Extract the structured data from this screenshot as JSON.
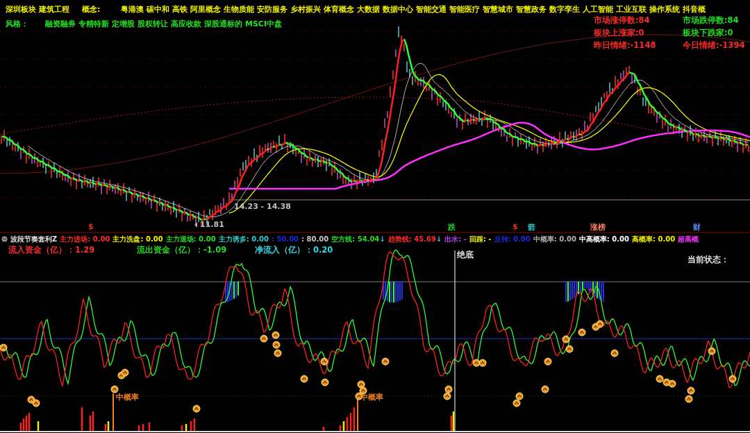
{
  "header": {
    "board": "深圳板块",
    "industry": "建筑工程",
    "concept_label": "概念:",
    "concepts": [
      "粤港澳",
      "碳中和",
      "高铁",
      "阿里概念",
      "生物质能",
      "安防服务",
      "乡村振兴",
      "体育概念",
      "大数据",
      "数据中心",
      "智能交通",
      "智能医疗",
      "智慧城市",
      "智慧政务",
      "数字孪生",
      "人工智能",
      "工业互联",
      "操作系统",
      "抖音概"
    ],
    "style_label": "风格：",
    "styles": [
      "融资融券",
      "专精特新",
      "定增股",
      "股权转让",
      "高应收款",
      "深股通标的",
      "MSCI中盘"
    ]
  },
  "stats": [
    {
      "text": "市场涨停数:84",
      "color": "#ff2a2a"
    },
    {
      "text": "市场跌停数:84",
      "color": "#22dd22"
    },
    {
      "text": "板块上涨家:0",
      "color": "#ff2a2a"
    },
    {
      "text": "板块下跌家:0",
      "color": "#22dd22"
    },
    {
      "text": "昨日情绪:-1148",
      "color": "#ff2a2a"
    },
    {
      "text": "今日情绪:-1394",
      "color": "#ff2a2a"
    }
  ],
  "price_labels": [
    "14.23 - 14.38",
    "11.81"
  ],
  "signal_marks": [
    {
      "text": "$",
      "color": "#e03020"
    },
    {
      "text": "跌",
      "color": "#22cc22"
    },
    {
      "text": "$",
      "color": "#e03020"
    },
    {
      "text": "箭",
      "color": "#30c8c8"
    },
    {
      "text": "涨榜",
      "color": "#ff8060"
    },
    {
      "text": "财",
      "color": "#5090ff"
    }
  ],
  "indicator": {
    "title": "波段节奏套利Z",
    "items": [
      {
        "label": "主力进场:",
        "value": "0.00",
        "color": "#ff2a2a"
      },
      {
        "label": "主力洗盘:",
        "value": "0.00",
        "color": "#f0f000"
      },
      {
        "label": "主力退场:",
        "value": "0.00",
        "color": "#22dd22"
      },
      {
        "label": "主力诱多:",
        "value": "0.00",
        "color": "#30c8c8"
      },
      {
        "label": ":",
        "value": "50.00",
        "color": "#1a2ad8"
      },
      {
        "label": ":",
        "value": "80.00",
        "color": "#c8c8c8"
      },
      {
        "label": "空方线:",
        "value": "54.04",
        "arrow": "↓",
        "color": "#22dd22"
      },
      {
        "label": "趋势线:",
        "value": "45.69",
        "arrow": "↓",
        "color": "#ff2a2a"
      },
      {
        "label": "出水:",
        "value": "-",
        "color": "#c040ff"
      },
      {
        "label": "回踩:",
        "value": "-",
        "color": "#f0f000"
      },
      {
        "label": "反转:",
        "value": "0.00",
        "color": "#1a2ad8"
      },
      {
        "label": "中概率:",
        "value": "0.00",
        "color": "#b0b0b0"
      },
      {
        "label": "中高概率:",
        "value": "0.00",
        "color": "#ffffff"
      },
      {
        "label": "高概率:",
        "value": "0.00",
        "color": "#f0f000"
      },
      {
        "label": "超高概",
        "value": "",
        "color": "#ff30ff"
      }
    ]
  },
  "flows": [
    {
      "text": "流入资金（亿）：1.29",
      "color": "#ff2a2a"
    },
    {
      "text": "流出资金（亿）：-1.09",
      "color": "#22dd22"
    },
    {
      "text": "净流入（亿）：0.20",
      "color": "#30d8e8"
    }
  ],
  "lower_labels": {
    "bottom_signal": "绝底",
    "status": "当前状态：",
    "probability": [
      "中概率",
      "中概率"
    ]
  }
}
